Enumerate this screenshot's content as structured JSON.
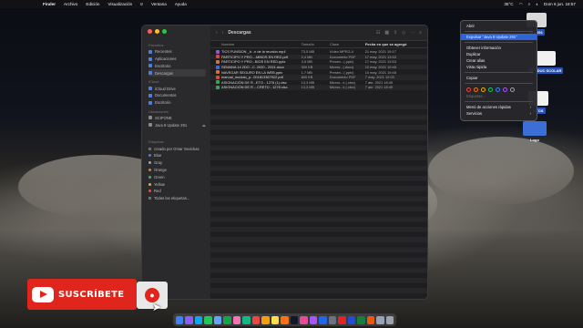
{
  "menubar": {
    "app": "Finder",
    "items": [
      "Archivo",
      "Edición",
      "Visualización",
      "Ir",
      "Ventana",
      "Ayuda"
    ],
    "temperature": "35°C",
    "time": "Dom 6 jun.  18:57"
  },
  "finder": {
    "title": "Descargas",
    "sidebar": {
      "favoritos_header": "Favoritos",
      "favoritos": [
        "Recientes",
        "Aplicaciones",
        "Escritorio",
        "Descargas"
      ],
      "icloud_header": "iCloud",
      "icloud": [
        "iCloud Drive",
        "Documentos",
        "Escritorio"
      ],
      "ubicaciones_header": "Ubicaciones",
      "ubicaciones": [
        "SCIFONE",
        "Java 8 Update 291"
      ],
      "etiquetas_header": "Etiquetas",
      "etiquetas": [
        "creado por Omar Sevickas",
        "Blue",
        "Gray",
        "Orange",
        "Green",
        "Yellow",
        "Red",
        "Todas las etiquetas..."
      ]
    },
    "columns": [
      "Nombre",
      "Tamaño",
      "Clase",
      "Fecha en que se agregó"
    ],
    "rows": [
      {
        "name": "TICS FUNSION _b...n de la reunión.mp4",
        "size": "73,5 MB",
        "kind": "Vídeo MPEG-4",
        "date": "21 may. 2021 19:17",
        "color": "#8a5bd6"
      },
      {
        "name": "PARTICIPO Y PRO....MBIOS EN RED.pdf",
        "size": "2,4 MB",
        "kind": "Documento PDF",
        "date": "17 may. 2021 13:53",
        "color": "#d94a3a"
      },
      {
        "name": "PARTICIPO Y PRO...BIOS EN RED.pptx",
        "size": "3,5 MB",
        "kind": "Presen...(.pptx)",
        "date": "17 may. 2021 13:53",
        "color": "#d9703a"
      },
      {
        "name": "SEMANA 14 2DO...C. 2020 - 2021.docx",
        "size": "300 KB",
        "kind": "Micros...(.docx)",
        "date": "10 may. 2021 19:48",
        "color": "#3a6fd9"
      },
      {
        "name": "NAVEGAR SEGURO EN LA WEB.pptx",
        "size": "1,7 MB",
        "kind": "Presen...(.pptx)",
        "date": "10 may. 2021 19:48",
        "color": "#d9703a"
      },
      {
        "name": "manual_modulo_p...001813367922.pdf",
        "size": "800 KB",
        "kind": "Documento PDF",
        "date": "7 may. 2021 12:03",
        "color": "#d94a3a"
      },
      {
        "name": "ASIGNACIÓN DE R...ETO - 1278 (1).xlsx",
        "size": "13,3 MB",
        "kind": "Micros...k (.xlsx)",
        "date": "7 abr. 2021 18:49",
        "color": "#3aa357"
      },
      {
        "name": "ASIGNACIÓN DE R....CRETO - 1278.xlsx",
        "size": "13,3 MB",
        "kind": "Micros...k (.xlsx)",
        "date": "7 abr. 2021 18:49",
        "color": "#3aa357"
      }
    ]
  },
  "context_menu": {
    "items": [
      {
        "label": "Abrir",
        "state": "normal"
      },
      {
        "label": "Expulsar \"Java 8 Update 291\"",
        "state": "highlight"
      },
      {
        "label": "Obtener información",
        "state": "normal"
      },
      {
        "label": "Duplicar",
        "state": "normal"
      },
      {
        "label": "Crear alias",
        "state": "normal"
      },
      {
        "label": "Vista rápida",
        "state": "normal"
      },
      {
        "label": "Copiar",
        "state": "normal"
      },
      {
        "label": "Etiquetas...",
        "state": "disabled"
      },
      {
        "label": "Menú de acciones rápidas",
        "state": "normal"
      },
      {
        "label": "Servicios",
        "state": "normal"
      }
    ]
  },
  "desktop_icons": [
    {
      "label": "ato 291"
    },
    {
      "label": "D_EDUC\nSCOLAR"
    },
    {
      "label": "NTOS"
    },
    {
      "label": "Logo"
    }
  ],
  "overlay": {
    "subscribe_label": "SUSCRÍBETE"
  },
  "colors": {
    "accent": "#2f64d6",
    "youtube_red": "#e0261c"
  }
}
